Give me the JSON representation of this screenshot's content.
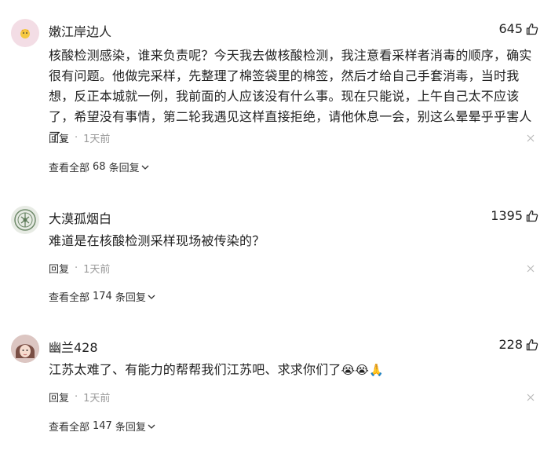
{
  "comments": [
    {
      "user": "嫩江岸边人",
      "likes": "645",
      "text": "核酸检测感染，谁来负责呢？今天我去做核酸检测，我注意看采样者消毒的顺序，确实很有问题。他做完采样，先整理了棉签袋里的棉签，然后才给自己手套消毒，当时我想，反正本城就一例，我前面的人应该没有什么事。现在只能说，上午自己太不应该了，希望没有事情，第二轮我遇见这样直接拒绝，请他休息一会，别这么晕晕乎乎害人了。",
      "reply_label": "回复",
      "time": "1天前",
      "view_all_prefix": "查看全部",
      "view_all_count": "68",
      "view_all_suffix": "条回复"
    },
    {
      "user": "大漠孤烟白",
      "likes": "1395",
      "text": "难道是在核酸检测采样现场被传染的？",
      "reply_label": "回复",
      "time": "1天前",
      "view_all_prefix": "查看全部",
      "view_all_count": "174",
      "view_all_suffix": "条回复"
    },
    {
      "user": "幽兰428",
      "likes": "228",
      "text": "江苏太难了、有能力的帮帮我们江苏吧、求求你们了",
      "emojis": "😭😭🙏",
      "reply_label": "回复",
      "time": "1天前",
      "view_all_prefix": "查看全部",
      "view_all_count": "147",
      "view_all_suffix": "条回复"
    }
  ],
  "icons": {
    "like": "thumbs-up-icon",
    "close": "close-icon",
    "expand": "chevron-down-icon"
  }
}
